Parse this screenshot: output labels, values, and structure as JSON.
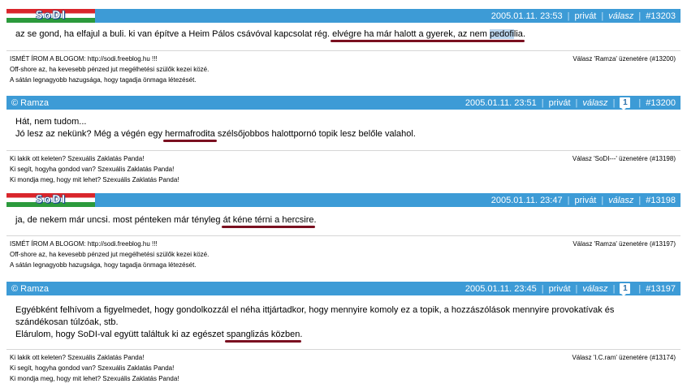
{
  "posts": [
    {
      "header": {
        "author": "",
        "logo_text": "SoDI",
        "date": "2005.01.11. 23:53",
        "private": "privát",
        "reply": "válasz",
        "badge": "",
        "id": "#13203"
      },
      "body": {
        "lines": [
          {
            "a": "az se gond, ha elfajul a buli. ki van építve a Heim Pálos csávóval kapcsolat rég. ",
            "u1": "elvégre ha már halott a gyerek, az nem ",
            "hl": "pedofi",
            "u2": "lia",
            "b": "."
          }
        ]
      },
      "sig": [
        "ISMÉT ÍROM A BLOGOM: http://sodi.freeblog.hu !!!",
        "Off-shore az, ha kevesebb pénzed jut megélhetési szülők kezei közé.",
        "A sátán legnagyobb hazugsága, hogy tagadja önmaga létezését."
      ],
      "reply_to": "Válasz 'Ramza' üzenetére (#13200)"
    },
    {
      "header": {
        "author": "© Ramza",
        "date": "2005.01.11. 23:51",
        "private": "privát",
        "reply": "válasz",
        "badge": "1",
        "id": "#13200"
      },
      "body": {
        "l1": "Hát, nem tudom...",
        "l2a": "Jó lesz az nekünk? Még a végén egy ",
        "l2u": "hermafrodita",
        "l2b": " szélsőjobbos halottpornó topik lesz belőle valahol."
      },
      "sig": [
        "Ki lakik ott keleten? Szexuális Zaklatás Panda!",
        "Ki segít, hogyha gondod van? Szexuális Zaklatás Panda!",
        "Ki mondja meg, hogy mit lehet? Szexuális Zaklatás Panda!"
      ],
      "reply_to": "Válasz 'SoDI---' üzenetére (#13198)"
    },
    {
      "header": {
        "author": "",
        "logo_text": "SoDI",
        "date": "2005.01.11. 23:47",
        "private": "privát",
        "reply": "válasz",
        "badge": "",
        "id": "#13198"
      },
      "body": {
        "a": "ja, de nekem már uncsi. most pénteken már tényleg ",
        "u": "át kéne térni a hercsire",
        "b": "."
      },
      "sig": [
        "ISMÉT ÍROM A BLOGOM: http://sodi.freeblog.hu !!!",
        "Off-shore az, ha kevesebb pénzed jut megélhetési szülők kezei közé.",
        "A sátán legnagyobb hazugsága, hogy tagadja önmaga létezését."
      ],
      "reply_to": "Válasz 'Ramza' üzenetére (#13197)"
    },
    {
      "header": {
        "author": "© Ramza",
        "date": "2005.01.11. 23:45",
        "private": "privát",
        "reply": "válasz",
        "badge": "1",
        "id": "#13197"
      },
      "body": {
        "l1": "Egyébként felhívom a figyelmedet, hogy gondolkozzál el néha ittjártadkor, hogy mennyire komoly ez a topik, a hozzászólások mennyire provokatívak és",
        "l2": "szándékosan túlzóak, stb.",
        "l3a": "Elárulom, hogy SoDI-val együtt találtuk ki az egészet ",
        "l3u": "spanglizás közben",
        "l3b": "."
      },
      "sig": [
        "Ki lakik ott keleten? Szexuális Zaklatás Panda!",
        "Ki segít, hogyha gondod van? Szexuális Zaklatás Panda!",
        "Ki mondja meg, hogy mit lehet? Szexuális Zaklatás Panda!"
      ],
      "reply_to": "Válasz 'I.C.ram' üzenetére (#13174)"
    }
  ]
}
